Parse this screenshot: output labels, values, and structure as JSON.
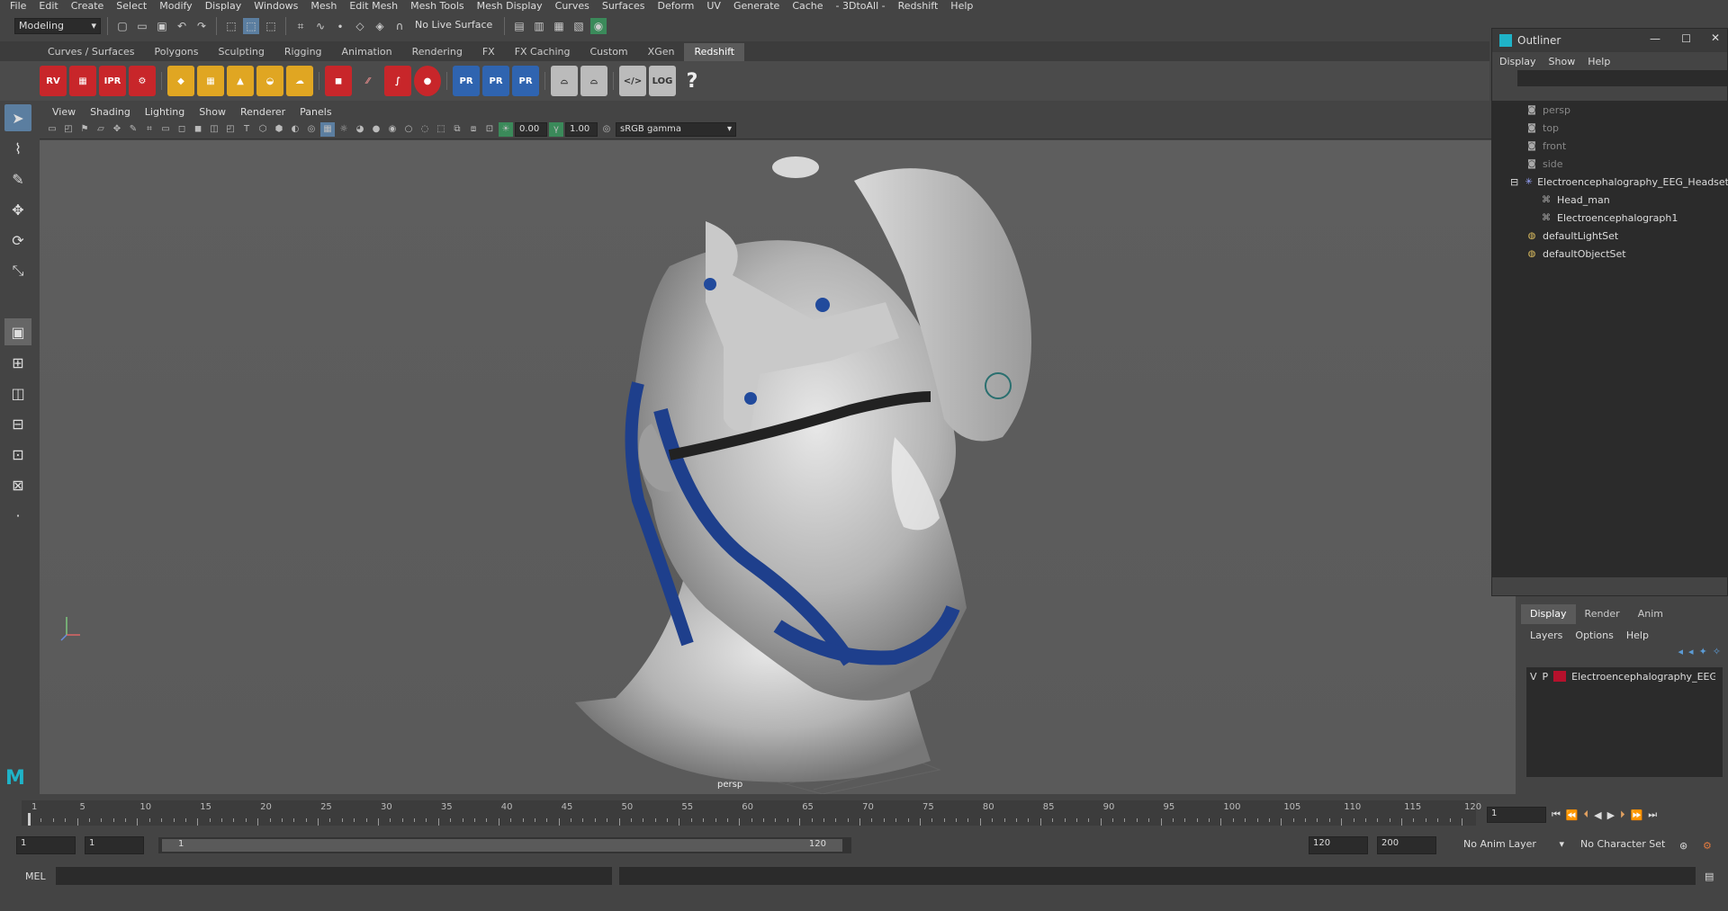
{
  "menubar": [
    "File",
    "Edit",
    "Create",
    "Select",
    "Modify",
    "Display",
    "Windows",
    "Mesh",
    "Edit Mesh",
    "Mesh Tools",
    "Mesh Display",
    "Curves",
    "Surfaces",
    "Deform",
    "UV",
    "Generate",
    "Cache",
    "- 3DtoAll -",
    "Redshift",
    "Help"
  ],
  "statusline": {
    "mode": "Modeling",
    "live_surface": "No Live Surface"
  },
  "shelf_tabs": [
    "Curves / Surfaces",
    "Polygons",
    "Sculpting",
    "Rigging",
    "Animation",
    "Rendering",
    "FX",
    "FX Caching",
    "Custom",
    "XGen",
    "Redshift"
  ],
  "shelf_active": "Redshift",
  "shelf_icons": {
    "rv": "RV",
    "ipr": "IPR",
    "pr1": "PR",
    "pr2": "PR",
    "pr3": "PR",
    "log": "LOG",
    "help": "?"
  },
  "panel_menu": [
    "View",
    "Shading",
    "Lighting",
    "Show",
    "Renderer",
    "Panels"
  ],
  "panel_toolbar": {
    "exposure": "0.00",
    "gamma": "1.00",
    "colorspace": "sRGB gamma"
  },
  "viewport": {
    "camera": "persp"
  },
  "outliner": {
    "title": "Outliner",
    "menu": [
      "Display",
      "Show",
      "Help"
    ],
    "items": [
      {
        "label": "persp",
        "indent": 1,
        "icon": "camera-icon",
        "dim": true
      },
      {
        "label": "top",
        "indent": 1,
        "icon": "camera-icon",
        "dim": true
      },
      {
        "label": "front",
        "indent": 1,
        "icon": "camera-icon",
        "dim": true
      },
      {
        "label": "side",
        "indent": 1,
        "icon": "camera-icon",
        "dim": true
      },
      {
        "label": "Electroencephalography_EEG_Headset",
        "indent": 0,
        "icon": "group-icon",
        "dim": false
      },
      {
        "label": "Head_man",
        "indent": 2,
        "icon": "mesh-icon",
        "dim": false
      },
      {
        "label": "Electroencephalograph1",
        "indent": 2,
        "icon": "mesh-icon",
        "dim": false
      },
      {
        "label": "defaultLightSet",
        "indent": 1,
        "icon": "set-icon",
        "dim": false
      },
      {
        "label": "defaultObjectSet",
        "indent": 1,
        "icon": "set-icon",
        "dim": false
      }
    ]
  },
  "layers": {
    "tabs": [
      "Display",
      "Render",
      "Anim"
    ],
    "menu": [
      "Layers",
      "Options",
      "Help"
    ],
    "layer": {
      "v": "V",
      "p": "P",
      "name": "Electroencephalography_EEG_Headset",
      "color": "#b5112c"
    }
  },
  "timeline": {
    "ticks": [
      1,
      5,
      10,
      15,
      20,
      25,
      30,
      35,
      40,
      45,
      50,
      55,
      60,
      65,
      70,
      75,
      80,
      85,
      90,
      95,
      100,
      105,
      110,
      115,
      120
    ],
    "current_frame": "1"
  },
  "range": {
    "start": "1",
    "playback_start": "1",
    "range_start": "1",
    "range_end": "120",
    "playback_end": "120",
    "end": "200",
    "anim_layer": "No Anim Layer",
    "character_set": "No Character Set"
  },
  "command": {
    "lang": "MEL"
  }
}
